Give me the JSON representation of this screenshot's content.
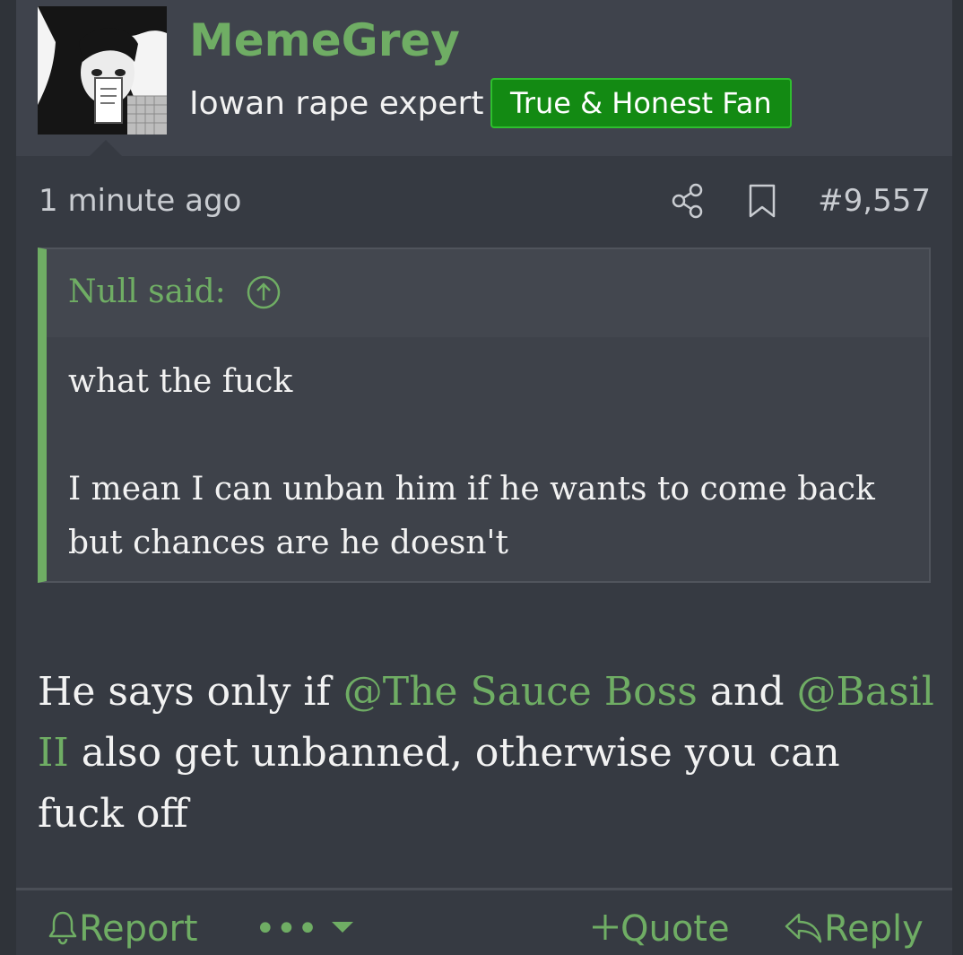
{
  "post": {
    "username": "MemeGrey",
    "user_title": "Iowan rape expert",
    "badge": "True & Honest Fan",
    "time": "1 minute ago",
    "post_number": "#9,557",
    "icons": {
      "share": "share-icon",
      "bookmark": "bookmark-icon"
    }
  },
  "quote": {
    "author": "Null said:",
    "line1": "what the fuck",
    "line2": "I mean I can unban him if he wants to come back but chances are he doesn't"
  },
  "message": {
    "part1": "He says only if ",
    "mention1": "@The Sauce Boss",
    "part2": " and ",
    "mention2": "@Basil II",
    "part3": " also get unbanned, otherwise you can fuck off"
  },
  "footer": {
    "report": "Report",
    "more": "•••",
    "quote": "Quote",
    "reply": "Reply"
  },
  "colors": {
    "accent": "#6fad64",
    "badge_bg": "#138a13",
    "post_bg": "#363a42",
    "header_bg": "#3f434c"
  }
}
